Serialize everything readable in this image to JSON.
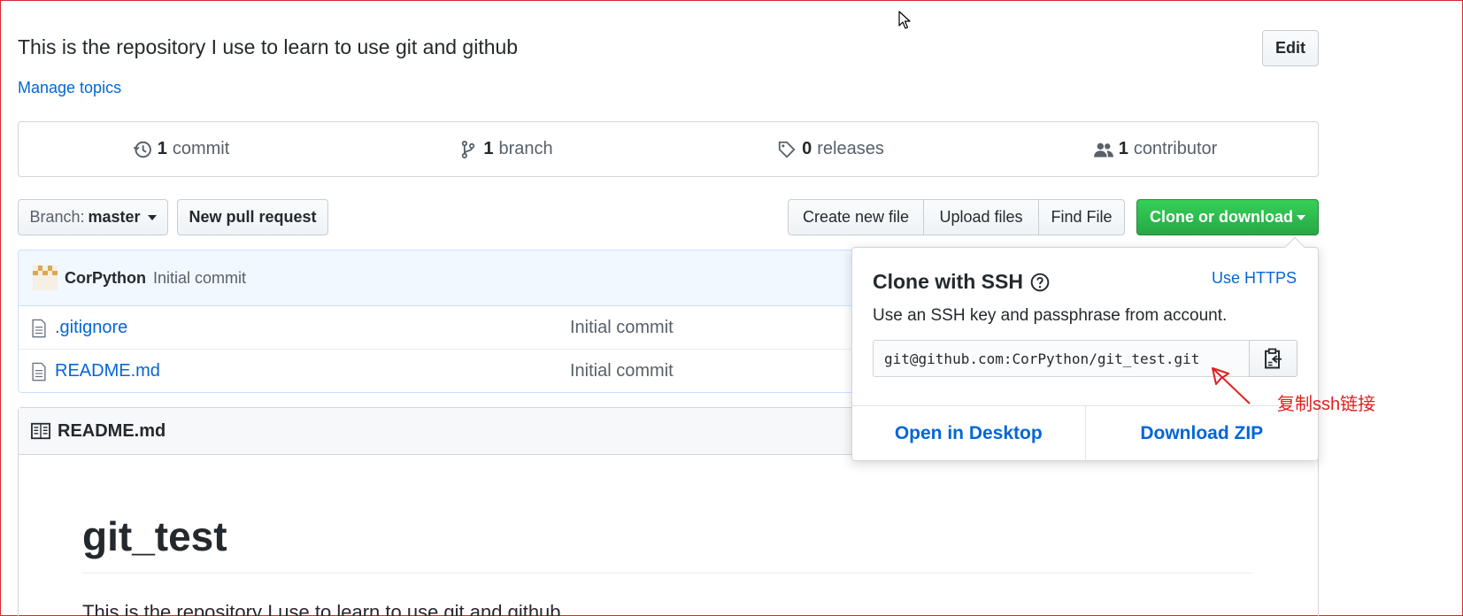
{
  "repo": {
    "description": "This is the repository I use to learn to use git and github",
    "edit_label": "Edit",
    "manage_topics": "Manage topics"
  },
  "stats": {
    "commits_count": "1",
    "commits_label": "commit",
    "branches_count": "1",
    "branches_label": "branch",
    "releases_count": "0",
    "releases_label": "releases",
    "contributors_count": "1",
    "contributors_label": "contributor"
  },
  "toolbar": {
    "branch_prefix": "Branch:",
    "branch_value": "master",
    "new_pull_request": "New pull request",
    "create_new_file": "Create new file",
    "upload_files": "Upload files",
    "find_file": "Find File",
    "clone_or_download": "Clone or download"
  },
  "commit": {
    "author": "CorPython",
    "message": "Initial commit"
  },
  "files": [
    {
      "name": ".gitignore",
      "message": "Initial commit"
    },
    {
      "name": "README.md",
      "message": "Initial commit"
    }
  ],
  "readme": {
    "header": "README.md",
    "title": "git_test",
    "body": "This is the repository I use to learn to use git and github"
  },
  "clone_popover": {
    "title": "Clone with SSH",
    "switch_link": "Use HTTPS",
    "description": "Use an SSH key and passphrase from account.",
    "ssh_url": "git@github.com:CorPython/git_test.git",
    "open_desktop": "Open in Desktop",
    "download_zip": "Download ZIP"
  },
  "annotation": {
    "text": "复制ssh链接",
    "color": "#e02020"
  },
  "colors": {
    "link": "#0366d6",
    "primary_green": "#28a745",
    "frame_border": "#d7282f"
  }
}
